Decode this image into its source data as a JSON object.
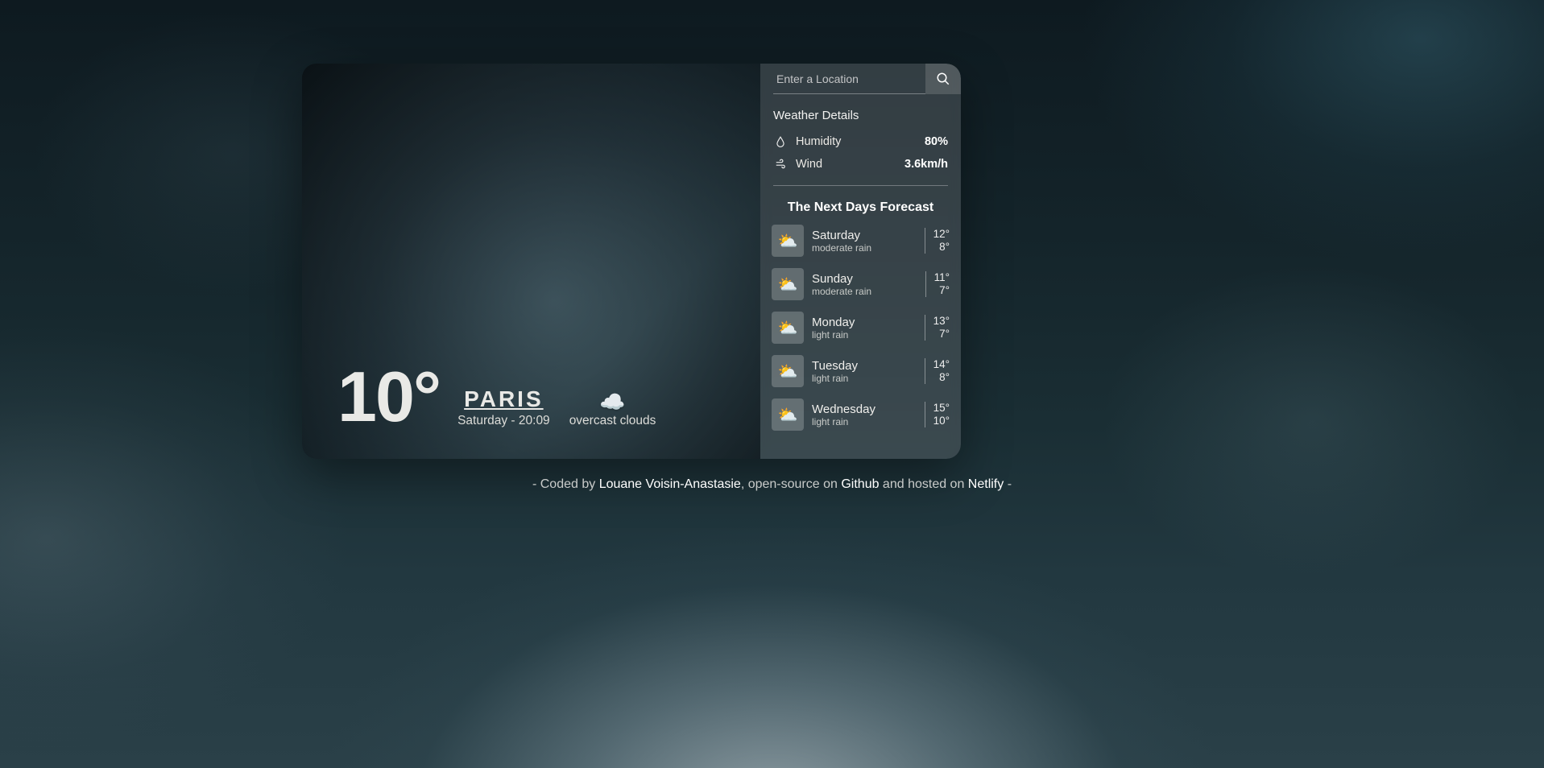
{
  "current": {
    "temp": "10°",
    "city": "PARIS",
    "datetime": "Saturday - 20:09",
    "condition": "overcast clouds",
    "condition_icon": "☁️"
  },
  "search": {
    "placeholder": "Enter a Location"
  },
  "details": {
    "title": "Weather Details",
    "humidity_label": "Humidity",
    "humidity_value": "80%",
    "wind_label": "Wind",
    "wind_value": "3.6km/h"
  },
  "forecast": {
    "title": "The Next Days Forecast",
    "items": [
      {
        "day": "Saturday",
        "desc": "moderate rain",
        "hi": "12°",
        "lo": "8°",
        "icon": "⛅"
      },
      {
        "day": "Sunday",
        "desc": "moderate rain",
        "hi": "11°",
        "lo": "7°",
        "icon": "⛅"
      },
      {
        "day": "Monday",
        "desc": "light rain",
        "hi": "13°",
        "lo": "7°",
        "icon": "⛅"
      },
      {
        "day": "Tuesday",
        "desc": "light rain",
        "hi": "14°",
        "lo": "8°",
        "icon": "⛅"
      },
      {
        "day": "Wednesday",
        "desc": "light rain",
        "hi": "15°",
        "lo": "10°",
        "icon": "⛅"
      }
    ]
  },
  "footer": {
    "prefix": "- Coded by ",
    "author": "Louane Voisin-Anastasie",
    "mid1": ", open-source on ",
    "github": "Github",
    "mid2": " and hosted on ",
    "host": "Netlify",
    "suffix": " -"
  }
}
